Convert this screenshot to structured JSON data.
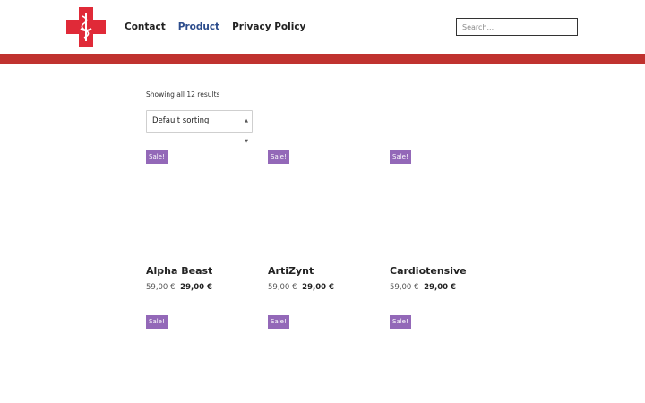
{
  "header": {
    "nav": [
      {
        "label": "Contact",
        "active": false
      },
      {
        "label": "Product",
        "active": true
      },
      {
        "label": "Privacy Policy",
        "active": false
      }
    ],
    "search_placeholder": "Search..."
  },
  "colors": {
    "brand_red": "#c0322f",
    "logo_red": "#e02a38",
    "sale_badge": "#9368b8",
    "active_nav": "#2c4c8c"
  },
  "shop": {
    "result_count": "Showing all 12 results",
    "sorting_selected": "Default sorting",
    "sale_label": "Sale!",
    "products": [
      {
        "name": "Alpha Beast",
        "old_price": "59,00 €",
        "new_price": "29,00 €"
      },
      {
        "name": "ArtiZynt",
        "old_price": "59,00 €",
        "new_price": "29,00 €"
      },
      {
        "name": "Cardiotensive",
        "old_price": "59,00 €",
        "new_price": "29,00 €"
      },
      {
        "name": "",
        "old_price": "",
        "new_price": ""
      },
      {
        "name": "",
        "old_price": "",
        "new_price": ""
      },
      {
        "name": "",
        "old_price": "",
        "new_price": ""
      }
    ]
  }
}
